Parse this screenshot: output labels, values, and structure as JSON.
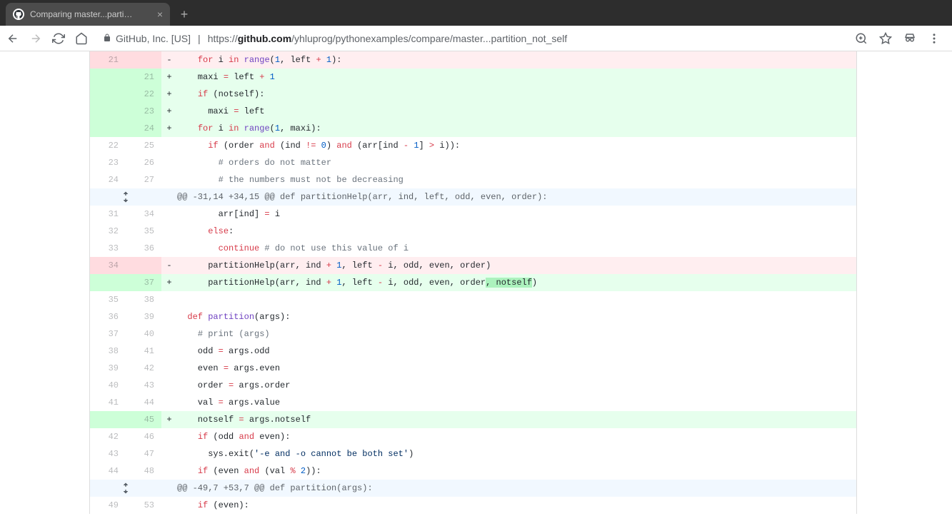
{
  "browser": {
    "tab_title": "Comparing master...parti…",
    "url_security": "GitHub, Inc. [US]",
    "url_scheme": "https://",
    "url_host": "github.com",
    "url_path": "/yhluprog/pythonexamples/compare/master...partition_not_self"
  },
  "diff": {
    "rows": [
      {
        "type": "del",
        "old": "21",
        "new": "",
        "sign": "-",
        "tokens": [
          [
            "",
            "    "
          ],
          [
            "kw",
            "for"
          ],
          [
            "",
            " i "
          ],
          [
            "kw",
            "in"
          ],
          [
            "",
            " "
          ],
          [
            "fn",
            "range"
          ],
          [
            "",
            "("
          ],
          [
            "num",
            "1"
          ],
          [
            "",
            ", left "
          ],
          [
            "op",
            "+"
          ],
          [
            "",
            " "
          ],
          [
            "num",
            "1"
          ],
          [
            "",
            "):"
          ]
        ]
      },
      {
        "type": "add",
        "old": "",
        "new": "21",
        "sign": "+",
        "tokens": [
          [
            "",
            "    maxi "
          ],
          [
            "op",
            "="
          ],
          [
            "",
            " left "
          ],
          [
            "op",
            "+"
          ],
          [
            "",
            " "
          ],
          [
            "num",
            "1"
          ]
        ]
      },
      {
        "type": "add",
        "old": "",
        "new": "22",
        "sign": "+",
        "tokens": [
          [
            "",
            "    "
          ],
          [
            "kw",
            "if"
          ],
          [
            "",
            " (notself):"
          ]
        ]
      },
      {
        "type": "add",
        "old": "",
        "new": "23",
        "sign": "+",
        "tokens": [
          [
            "",
            "      maxi "
          ],
          [
            "op",
            "="
          ],
          [
            "",
            " left"
          ]
        ]
      },
      {
        "type": "add",
        "old": "",
        "new": "24",
        "sign": "+",
        "tokens": [
          [
            "",
            "    "
          ],
          [
            "kw",
            "for"
          ],
          [
            "",
            " i "
          ],
          [
            "kw",
            "in"
          ],
          [
            "",
            " "
          ],
          [
            "fn",
            "range"
          ],
          [
            "",
            "("
          ],
          [
            "num",
            "1"
          ],
          [
            "",
            ", maxi):"
          ]
        ]
      },
      {
        "type": "ctx",
        "old": "22",
        "new": "25",
        "sign": "",
        "tokens": [
          [
            "",
            "      "
          ],
          [
            "kw",
            "if"
          ],
          [
            "",
            " (order "
          ],
          [
            "kw",
            "and"
          ],
          [
            "",
            " (ind "
          ],
          [
            "op",
            "!="
          ],
          [
            "",
            " "
          ],
          [
            "num",
            "0"
          ],
          [
            "",
            ") "
          ],
          [
            "kw",
            "and"
          ],
          [
            "",
            " (arr[ind "
          ],
          [
            "op",
            "-"
          ],
          [
            "",
            " "
          ],
          [
            "num",
            "1"
          ],
          [
            "",
            "] "
          ],
          [
            "op",
            ">"
          ],
          [
            "",
            " i)):"
          ]
        ]
      },
      {
        "type": "ctx",
        "old": "23",
        "new": "26",
        "sign": "",
        "tokens": [
          [
            "",
            "        "
          ],
          [
            "cm",
            "# orders do not matter"
          ]
        ]
      },
      {
        "type": "ctx",
        "old": "24",
        "new": "27",
        "sign": "",
        "tokens": [
          [
            "",
            "        "
          ],
          [
            "cm",
            "# the numbers must not be decreasing"
          ]
        ]
      },
      {
        "type": "hunk",
        "text": "@@ -31,14 +34,15 @@ def partitionHelp(arr, ind, left, odd, even, order):"
      },
      {
        "type": "ctx",
        "old": "31",
        "new": "34",
        "sign": "",
        "tokens": [
          [
            "",
            "        arr[ind] "
          ],
          [
            "op",
            "="
          ],
          [
            "",
            " i"
          ]
        ]
      },
      {
        "type": "ctx",
        "old": "32",
        "new": "35",
        "sign": "",
        "tokens": [
          [
            "",
            "      "
          ],
          [
            "kw",
            "else"
          ],
          [
            "",
            ":"
          ]
        ]
      },
      {
        "type": "ctx",
        "old": "33",
        "new": "36",
        "sign": "",
        "tokens": [
          [
            "",
            "        "
          ],
          [
            "kw",
            "continue"
          ],
          [
            "",
            " "
          ],
          [
            "cm",
            "# do not use this value of i"
          ]
        ]
      },
      {
        "type": "del",
        "old": "34",
        "new": "",
        "sign": "-",
        "tokens": [
          [
            "",
            "      partitionHelp(arr, ind "
          ],
          [
            "op",
            "+"
          ],
          [
            "",
            " "
          ],
          [
            "num",
            "1"
          ],
          [
            "",
            ", left "
          ],
          [
            "op",
            "-"
          ],
          [
            "",
            " i, odd, even, order)"
          ]
        ]
      },
      {
        "type": "add",
        "old": "",
        "new": "37",
        "sign": "+",
        "tokens": [
          [
            "",
            "      partitionHelp(arr, ind "
          ],
          [
            "op",
            "+"
          ],
          [
            "",
            " "
          ],
          [
            "num",
            "1"
          ],
          [
            "",
            ", left "
          ],
          [
            "op",
            "-"
          ],
          [
            "",
            " i, odd, even, order"
          ],
          [
            "hl-add",
            ", notself"
          ],
          [
            "",
            ")"
          ]
        ]
      },
      {
        "type": "ctx",
        "old": "35",
        "new": "38",
        "sign": "",
        "tokens": [
          [
            "",
            ""
          ]
        ]
      },
      {
        "type": "ctx",
        "old": "36",
        "new": "39",
        "sign": "",
        "tokens": [
          [
            "",
            "  "
          ],
          [
            "kw",
            "def"
          ],
          [
            "",
            " "
          ],
          [
            "fn",
            "partition"
          ],
          [
            "",
            "(args):"
          ]
        ]
      },
      {
        "type": "ctx",
        "old": "37",
        "new": "40",
        "sign": "",
        "tokens": [
          [
            "",
            "    "
          ],
          [
            "cm",
            "# print (args)"
          ]
        ]
      },
      {
        "type": "ctx",
        "old": "38",
        "new": "41",
        "sign": "",
        "tokens": [
          [
            "",
            "    odd "
          ],
          [
            "op",
            "="
          ],
          [
            "",
            " args.odd"
          ]
        ]
      },
      {
        "type": "ctx",
        "old": "39",
        "new": "42",
        "sign": "",
        "tokens": [
          [
            "",
            "    even "
          ],
          [
            "op",
            "="
          ],
          [
            "",
            " args.even"
          ]
        ]
      },
      {
        "type": "ctx",
        "old": "40",
        "new": "43",
        "sign": "",
        "tokens": [
          [
            "",
            "    order "
          ],
          [
            "op",
            "="
          ],
          [
            "",
            " args.order"
          ]
        ]
      },
      {
        "type": "ctx",
        "old": "41",
        "new": "44",
        "sign": "",
        "tokens": [
          [
            "",
            "    val "
          ],
          [
            "op",
            "="
          ],
          [
            "",
            " args.value"
          ]
        ]
      },
      {
        "type": "add",
        "old": "",
        "new": "45",
        "sign": "+",
        "tokens": [
          [
            "",
            "    notself "
          ],
          [
            "op",
            "="
          ],
          [
            "",
            " args.notself"
          ]
        ]
      },
      {
        "type": "ctx",
        "old": "42",
        "new": "46",
        "sign": "",
        "tokens": [
          [
            "",
            "    "
          ],
          [
            "kw",
            "if"
          ],
          [
            "",
            " (odd "
          ],
          [
            "kw",
            "and"
          ],
          [
            "",
            " even):"
          ]
        ]
      },
      {
        "type": "ctx",
        "old": "43",
        "new": "47",
        "sign": "",
        "tokens": [
          [
            "",
            "      sys.exit("
          ],
          [
            "st",
            "'-e and -o cannot be both set'"
          ],
          [
            "",
            ")"
          ]
        ]
      },
      {
        "type": "ctx",
        "old": "44",
        "new": "48",
        "sign": "",
        "tokens": [
          [
            "",
            "    "
          ],
          [
            "kw",
            "if"
          ],
          [
            "",
            " (even "
          ],
          [
            "kw",
            "and"
          ],
          [
            "",
            " (val "
          ],
          [
            "op",
            "%"
          ],
          [
            "",
            " "
          ],
          [
            "num",
            "2"
          ],
          [
            "",
            ")):"
          ]
        ]
      },
      {
        "type": "hunk",
        "text": "@@ -49,7 +53,7 @@ def partition(args):"
      },
      {
        "type": "ctx",
        "old": "49",
        "new": "53",
        "sign": "",
        "tokens": [
          [
            "",
            "    "
          ],
          [
            "kw",
            "if"
          ],
          [
            "",
            " (even):"
          ]
        ]
      }
    ]
  }
}
